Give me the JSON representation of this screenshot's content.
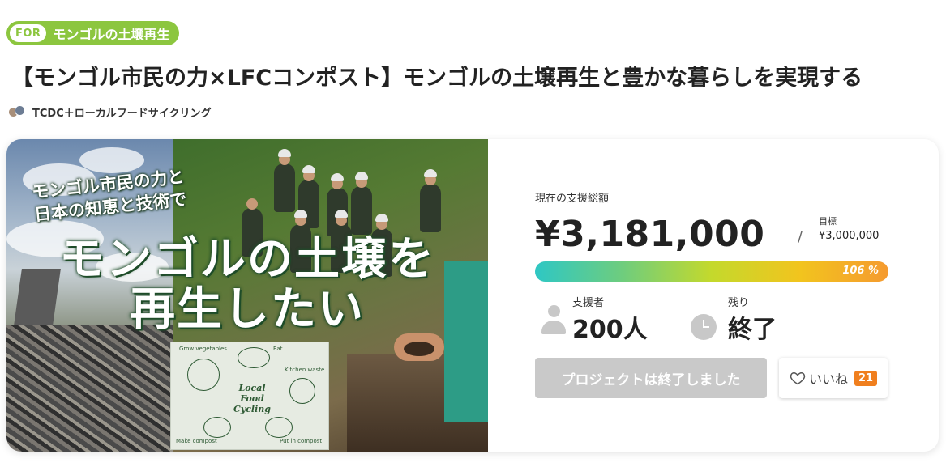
{
  "tag": {
    "for_label": "FOR",
    "category": "モンゴルの土壌再生"
  },
  "title": "【モンゴル市民の力×LFCコンポスト】モンゴルの土壌再生と豊かな暮らしを実現する",
  "owner": {
    "name": "TCDC＋ローカルフードサイクリング"
  },
  "hero": {
    "subtitle_line1": "モンゴル市民の力と",
    "subtitle_line2": "日本の知恵と技術で",
    "headline_line1": "モンゴルの土壌を",
    "headline_line2": "再生したい",
    "diagram": {
      "center": [
        "Local",
        "Food",
        "Cycling"
      ],
      "labels": [
        "Grow vegetables",
        "Eat",
        "Kitchen waste",
        "Make compost",
        "Put in compost"
      ]
    }
  },
  "funding": {
    "total_label": "現在の支援総額",
    "total_amount": "¥3,181,000",
    "slash": "/",
    "goal_label": "目標",
    "goal_amount": "¥3,000,000",
    "progress_percent": 106,
    "progress_label": "106 %",
    "supporters_label": "支援者",
    "supporters_value": "200人",
    "remaining_label": "残り",
    "remaining_value": "終了"
  },
  "actions": {
    "ended_label": "プロジェクトは終了しました",
    "like_label": "いいね",
    "like_count": "21"
  },
  "colors": {
    "tag_green": "#8cc63f",
    "progress_start": "#2ec7c4",
    "progress_end": "#f59a2f",
    "like_badge": "#f07f1e",
    "disabled_button": "#c9c9c9"
  },
  "icons": [
    "user-icon",
    "clock-icon",
    "heart-icon"
  ]
}
